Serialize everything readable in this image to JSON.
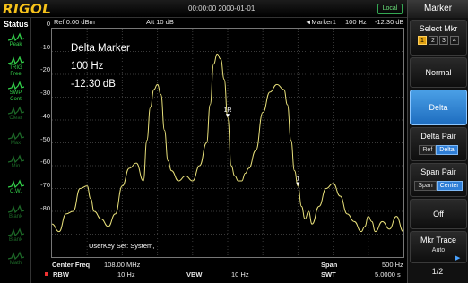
{
  "brand": "RIGOL",
  "datetime": "00:00:00  2000-01-01",
  "local_label": "Local",
  "status": {
    "title": "Status",
    "items": [
      {
        "label": "Peak",
        "icon": "peak-icon",
        "active": true
      },
      {
        "label": "TRIG Free",
        "icon": "trigger-free-icon",
        "active": true
      },
      {
        "label": "SWP Cont",
        "icon": "sweep-cont-icon",
        "active": true
      },
      {
        "label": "Clear",
        "icon": "trace-clear-icon",
        "active": false
      },
      {
        "label": "Max",
        "icon": "trace-max-icon",
        "active": false
      },
      {
        "label": "Min",
        "icon": "trace-min-icon",
        "active": false
      },
      {
        "label": "C.W.",
        "icon": "trace-clearwrite-icon",
        "active": true
      },
      {
        "label": "Blank",
        "icon": "trace-blank-icon",
        "active": false
      },
      {
        "label": "Blank",
        "icon": "trace-blank2-icon",
        "active": false
      },
      {
        "label": "Math",
        "icon": "trace-math-icon",
        "active": false
      }
    ]
  },
  "header": {
    "ref": "Ref  0.00 dBm",
    "att": "Att    10 dB",
    "marker_name": "◄Marker1",
    "marker_freq": "100 Hz",
    "marker_level": "-12.30 dB"
  },
  "y_axis": {
    "ticks": [
      "0",
      "-10",
      "-20",
      "-30",
      "-40",
      "-50",
      "-60",
      "-70",
      "-80"
    ]
  },
  "marker_box": {
    "title": "Delta Marker",
    "freq": "100 Hz",
    "level": "-12.30 dB"
  },
  "markers": [
    {
      "label": "1R",
      "x_hz": 0
    },
    {
      "label": "1",
      "x_hz": 100
    }
  ],
  "userkey": "UserKey Set:    System,",
  "bottom": {
    "center_label": "Center Freq",
    "center_value": "108.00 MHz",
    "rbw_label": "RBW",
    "rbw_value": "10 Hz",
    "vbw_label": "VBW",
    "vbw_value": "10 Hz",
    "span_label": "Span",
    "span_value": "500 Hz",
    "swt_label": "SWT",
    "swt_value": "5.0000 s"
  },
  "menu": {
    "title": "Marker",
    "select_label": "Select Mkr",
    "select_options": [
      "1",
      "2",
      "3",
      "4"
    ],
    "select_active": "1",
    "normal": "Normal",
    "delta": "Delta",
    "delta_pair": "Delta Pair",
    "delta_pair_opts": [
      "Ref",
      "Delta"
    ],
    "span_pair": "Span Pair",
    "span_pair_opts": [
      "Span",
      "Center"
    ],
    "off": "Off",
    "mkr_trace": "Mkr Trace",
    "mkr_trace_value": "Auto",
    "page": "1/2"
  },
  "colors": {
    "trace": "#e8e07a",
    "brand": "#f6c21a",
    "accent": "#2f7ed6",
    "status_green": "#33d24a"
  },
  "chart_data": {
    "type": "line",
    "xlabel": "",
    "ylabel": "",
    "xlim": [
      -250,
      250
    ],
    "ylim": [
      -90,
      0
    ],
    "grid": true,
    "series": [
      {
        "x": [
          -250,
          -240,
          -230,
          -220,
          -210,
          -200,
          -195,
          -190,
          -180,
          -170,
          -160,
          -150,
          -140,
          -130,
          -120,
          -115,
          -110,
          -105,
          -100,
          -95,
          -90,
          -85,
          -80,
          -70,
          -60,
          -50,
          -40,
          -30,
          -25,
          -20,
          -15,
          -10,
          -5,
          0,
          5,
          10,
          15,
          20,
          25,
          30,
          40,
          50,
          60,
          70,
          80,
          85,
          90,
          95,
          100,
          105,
          110,
          115,
          120,
          130,
          140,
          150,
          160,
          170,
          180,
          190,
          195,
          200,
          205,
          210,
          220,
          230,
          240,
          250
        ],
        "y": [
          -77,
          -80,
          -73,
          -72,
          -63,
          -62,
          -67,
          -72,
          -75,
          -78,
          -73,
          -62,
          -55,
          -53,
          -60,
          -44,
          -31,
          -24,
          -22,
          -26,
          -40,
          -52,
          -56,
          -60,
          -58,
          -60,
          -54,
          -45,
          -30,
          -14,
          -10,
          -12,
          -20,
          -35,
          -54,
          -58,
          -60,
          -60,
          -57,
          -55,
          -48,
          -33,
          -25,
          -22,
          -24,
          -30,
          -44,
          -56,
          -62,
          -70,
          -75,
          -72,
          -77,
          -70,
          -63,
          -61,
          -66,
          -73,
          -76,
          -80,
          -78,
          -74,
          -76,
          -80,
          -76,
          -79,
          -74,
          -80
        ]
      }
    ]
  }
}
